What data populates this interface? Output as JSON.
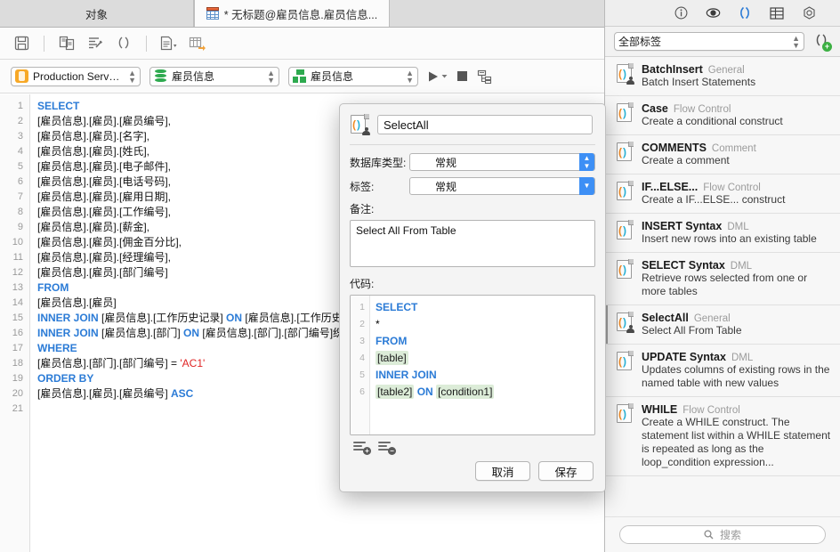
{
  "tabs": [
    {
      "label": "对象",
      "icon": null,
      "active": false
    },
    {
      "label": "* 无标题@雇员信息.雇员信息...",
      "icon": "grid-table-icon",
      "active": true
    }
  ],
  "toolbar": {
    "buttons": [
      {
        "name": "save-icon",
        "glyph": "save"
      },
      {
        "name": "copy-icon",
        "glyph": "copy"
      },
      {
        "name": "format-sql-icon",
        "glyph": "format"
      },
      {
        "name": "snippet-icon",
        "glyph": "parens"
      },
      {
        "name": "new-document-icon",
        "glyph": "doc-dropdown"
      },
      {
        "name": "export-grid-icon",
        "glyph": "grid-export"
      }
    ]
  },
  "connection_bar": {
    "server": "Production Server...",
    "database": "雇员信息",
    "schema": "雇员信息",
    "run_label": "▶",
    "stop_label": "■"
  },
  "editor": {
    "lines": [
      {
        "n": "1",
        "segments": [
          {
            "t": "SELECT",
            "c": "kw"
          }
        ]
      },
      {
        "n": "2",
        "segments": [
          {
            "t": "[雇员信息].[雇员].[雇员编号],",
            "c": ""
          }
        ]
      },
      {
        "n": "3",
        "segments": [
          {
            "t": "[雇员信息].[雇员].[名字],",
            "c": ""
          }
        ]
      },
      {
        "n": "4",
        "segments": [
          {
            "t": "[雇员信息].[雇员].[姓氏],",
            "c": ""
          }
        ]
      },
      {
        "n": "5",
        "segments": [
          {
            "t": "[雇员信息].[雇员].[电子邮件],",
            "c": ""
          }
        ]
      },
      {
        "n": "6",
        "segments": [
          {
            "t": "[雇员信息].[雇员].[电话号码],",
            "c": ""
          }
        ]
      },
      {
        "n": "7",
        "segments": [
          {
            "t": "[雇员信息].[雇员].[雇用日期],",
            "c": ""
          }
        ]
      },
      {
        "n": "8",
        "segments": [
          {
            "t": "[雇员信息].[雇员].[工作编号],",
            "c": ""
          }
        ]
      },
      {
        "n": "9",
        "segments": [
          {
            "t": "[雇员信息].[雇员].[薪金],",
            "c": ""
          }
        ]
      },
      {
        "n": "10",
        "segments": [
          {
            "t": "[雇员信息].[雇员].[佣金百分比],",
            "c": ""
          }
        ]
      },
      {
        "n": "11",
        "segments": [
          {
            "t": "[雇员信息].[雇员].[经理编号],",
            "c": ""
          }
        ]
      },
      {
        "n": "12",
        "segments": [
          {
            "t": "[雇员信息].[雇员].[部门编号]",
            "c": ""
          }
        ]
      },
      {
        "n": "13",
        "segments": [
          {
            "t": "FROM",
            "c": "kw"
          }
        ]
      },
      {
        "n": "14",
        "segments": [
          {
            "t": "[雇员信息].[雇员]",
            "c": ""
          }
        ]
      },
      {
        "n": "15",
        "segments": [
          {
            "t": "INNER JOIN ",
            "c": "kw"
          },
          {
            "t": "[雇员信息].[工作历史记录] ",
            "c": ""
          },
          {
            "t": "ON ",
            "c": "kw"
          },
          {
            "t": "[雇员信息].[工作历史",
            "c": ""
          }
        ]
      },
      {
        "n": "16",
        "segments": [
          {
            "t": "INNER JOIN ",
            "c": "kw"
          },
          {
            "t": "[雇员信息].[部门] ",
            "c": ""
          },
          {
            "t": "ON ",
            "c": "kw"
          },
          {
            "t": "[雇员信息].[部门].[部门编号]织",
            "c": ""
          }
        ]
      },
      {
        "n": "17",
        "segments": [
          {
            "t": "WHERE",
            "c": "kw"
          }
        ]
      },
      {
        "n": "18",
        "segments": [
          {
            "t": "[雇员信息].[部门].[部门编号] = ",
            "c": ""
          },
          {
            "t": "'AC1'",
            "c": "str"
          }
        ]
      },
      {
        "n": "19",
        "segments": [
          {
            "t": "ORDER BY",
            "c": "kw"
          }
        ]
      },
      {
        "n": "20",
        "segments": [
          {
            "t": "[雇员信息].[雇员].[雇员编号] ",
            "c": ""
          },
          {
            "t": "ASC",
            "c": "kw"
          }
        ]
      },
      {
        "n": "21",
        "segments": [
          {
            "t": "",
            "c": ""
          }
        ]
      }
    ]
  },
  "sidebar": {
    "icon_tabs": [
      {
        "name": "info-icon",
        "glyph": "ⓘ",
        "active": false
      },
      {
        "name": "preview-eye-icon",
        "glyph": "◉",
        "active": false
      },
      {
        "name": "snippets-icon",
        "glyph": "( )",
        "active": true
      },
      {
        "name": "table-icon",
        "glyph": "▦",
        "active": false
      },
      {
        "name": "settings-hex-icon",
        "glyph": "⬡",
        "active": false
      }
    ],
    "filter": {
      "value": "全部标签"
    },
    "add_snippet_label": "+",
    "snippets": [
      {
        "title": "BatchInsert",
        "category": "General",
        "desc": "Batch Insert Statements",
        "person": true,
        "selected": false
      },
      {
        "title": "Case",
        "category": "Flow Control",
        "desc": "Create a conditional construct",
        "person": false,
        "selected": false
      },
      {
        "title": "COMMENTS",
        "category": "Comment",
        "desc": "Create a comment",
        "person": false,
        "selected": false
      },
      {
        "title": "IF...ELSE...",
        "category": "Flow Control",
        "desc": "Create a IF...ELSE... construct",
        "person": false,
        "selected": false
      },
      {
        "title": "INSERT Syntax",
        "category": "DML",
        "desc": "Insert new rows into an existing table",
        "person": false,
        "selected": false
      },
      {
        "title": "SELECT Syntax",
        "category": "DML",
        "desc": "Retrieve rows selected from one or more tables",
        "person": false,
        "selected": false
      },
      {
        "title": "SelectAll",
        "category": "General",
        "desc": "Select All From Table",
        "person": true,
        "selected": true
      },
      {
        "title": "UPDATE Syntax",
        "category": "DML",
        "desc": "Updates columns of existing rows in the named table with new values",
        "person": false,
        "selected": false
      },
      {
        "title": "WHILE",
        "category": "Flow Control",
        "desc": "Create a WHILE construct. The statement list within a WHILE statement is repeated as long as the loop_condition expression...",
        "person": false,
        "selected": false
      }
    ],
    "search": {
      "placeholder": "搜索",
      "value": ""
    }
  },
  "modal": {
    "name_value": "SelectAll",
    "db_type_label": "数据库类型:",
    "db_type_value": "常规",
    "tag_label": "标签:",
    "tag_value": "常规",
    "notes_label": "备注:",
    "notes_value": "Select All From Table",
    "code_label": "代码:",
    "code_lines": [
      {
        "n": "1",
        "segments": [
          {
            "t": "SELECT",
            "c": "kw"
          }
        ]
      },
      {
        "n": "2",
        "segments": [
          {
            "t": "*",
            "c": ""
          }
        ]
      },
      {
        "n": "3",
        "segments": [
          {
            "t": "FROM",
            "c": "kw"
          }
        ]
      },
      {
        "n": "4",
        "segments": [
          {
            "t": "[table]",
            "c": "tok"
          }
        ]
      },
      {
        "n": "5",
        "segments": [
          {
            "t": "INNER JOIN",
            "c": "kw"
          }
        ]
      },
      {
        "n": "6",
        "segments": [
          {
            "t": "[table2]",
            "c": "tok"
          },
          {
            "t": " ",
            "c": ""
          },
          {
            "t": "ON",
            "c": "kw"
          },
          {
            "t": " ",
            "c": ""
          },
          {
            "t": "[condition1]",
            "c": "tok"
          }
        ]
      }
    ],
    "add_param_label": "+",
    "remove_param_label": "−",
    "cancel_label": "取消",
    "save_label": "保存"
  },
  "colors": {
    "accent_blue": "#2b7bd6",
    "select_blue": "#3d8ff5",
    "token_green": "#dcecd8",
    "string_red": "#e02424"
  }
}
